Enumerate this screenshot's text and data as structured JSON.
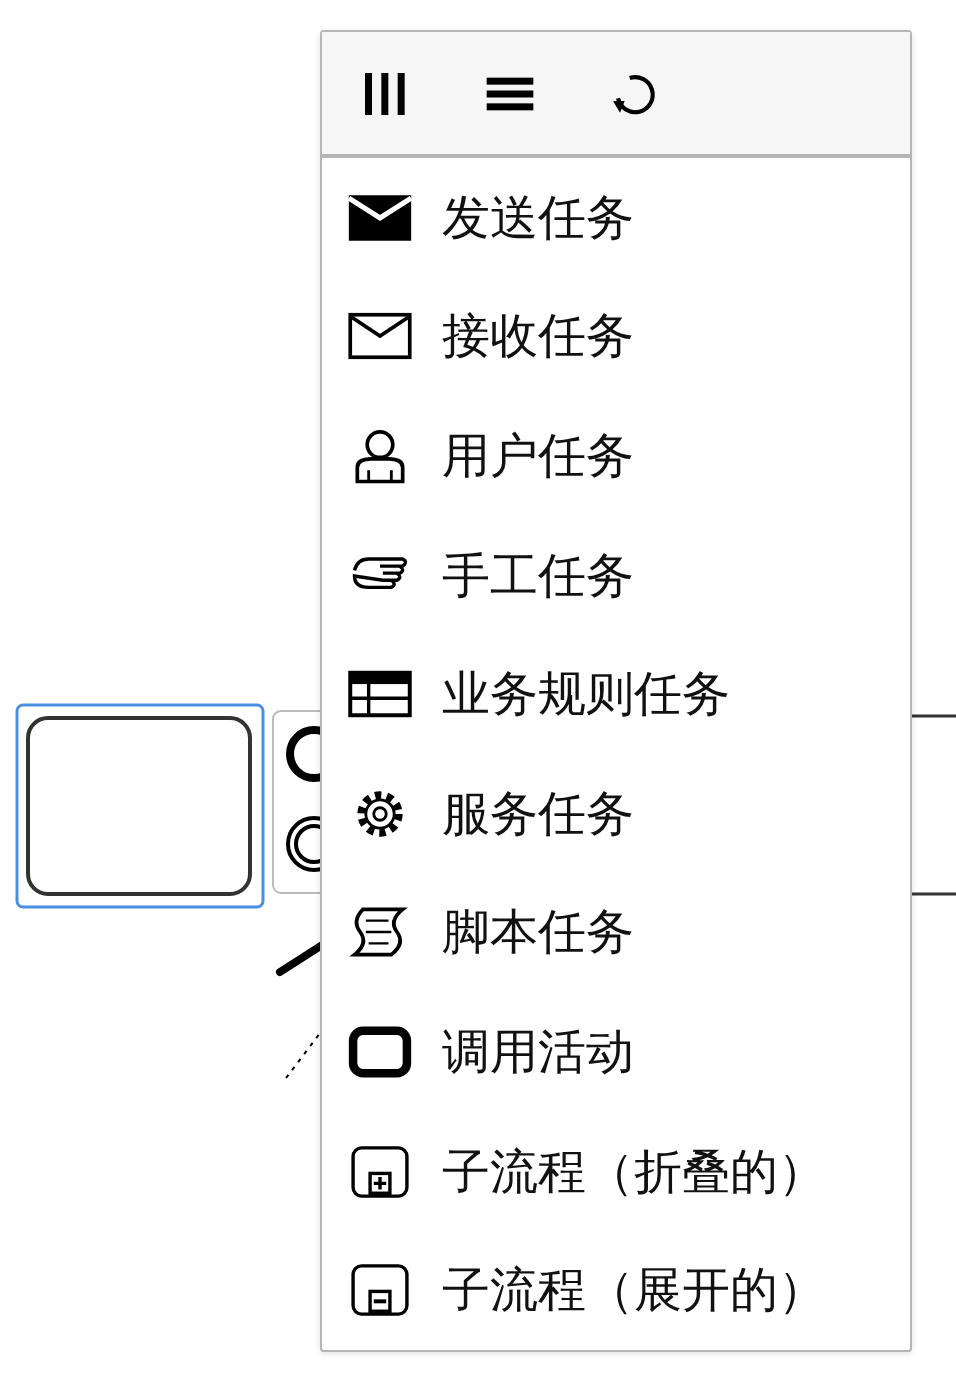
{
  "header_actions": [
    {
      "kind": "columns"
    },
    {
      "kind": "rows"
    },
    {
      "kind": "rotate"
    }
  ],
  "menu_items": [
    {
      "kind": "send",
      "label": "发送任务"
    },
    {
      "kind": "receive",
      "label": "接收任务"
    },
    {
      "kind": "user",
      "label": "用户任务"
    },
    {
      "kind": "manual",
      "label": "手工任务"
    },
    {
      "kind": "rule",
      "label": "业务规则任务"
    },
    {
      "kind": "service",
      "label": "服务任务"
    },
    {
      "kind": "script",
      "label": "脚本任务"
    },
    {
      "kind": "call",
      "label": "调用活动"
    },
    {
      "kind": "collapsed",
      "label": "子流程（折叠的）"
    },
    {
      "kind": "expanded",
      "label": "子流程（展开的）"
    }
  ]
}
